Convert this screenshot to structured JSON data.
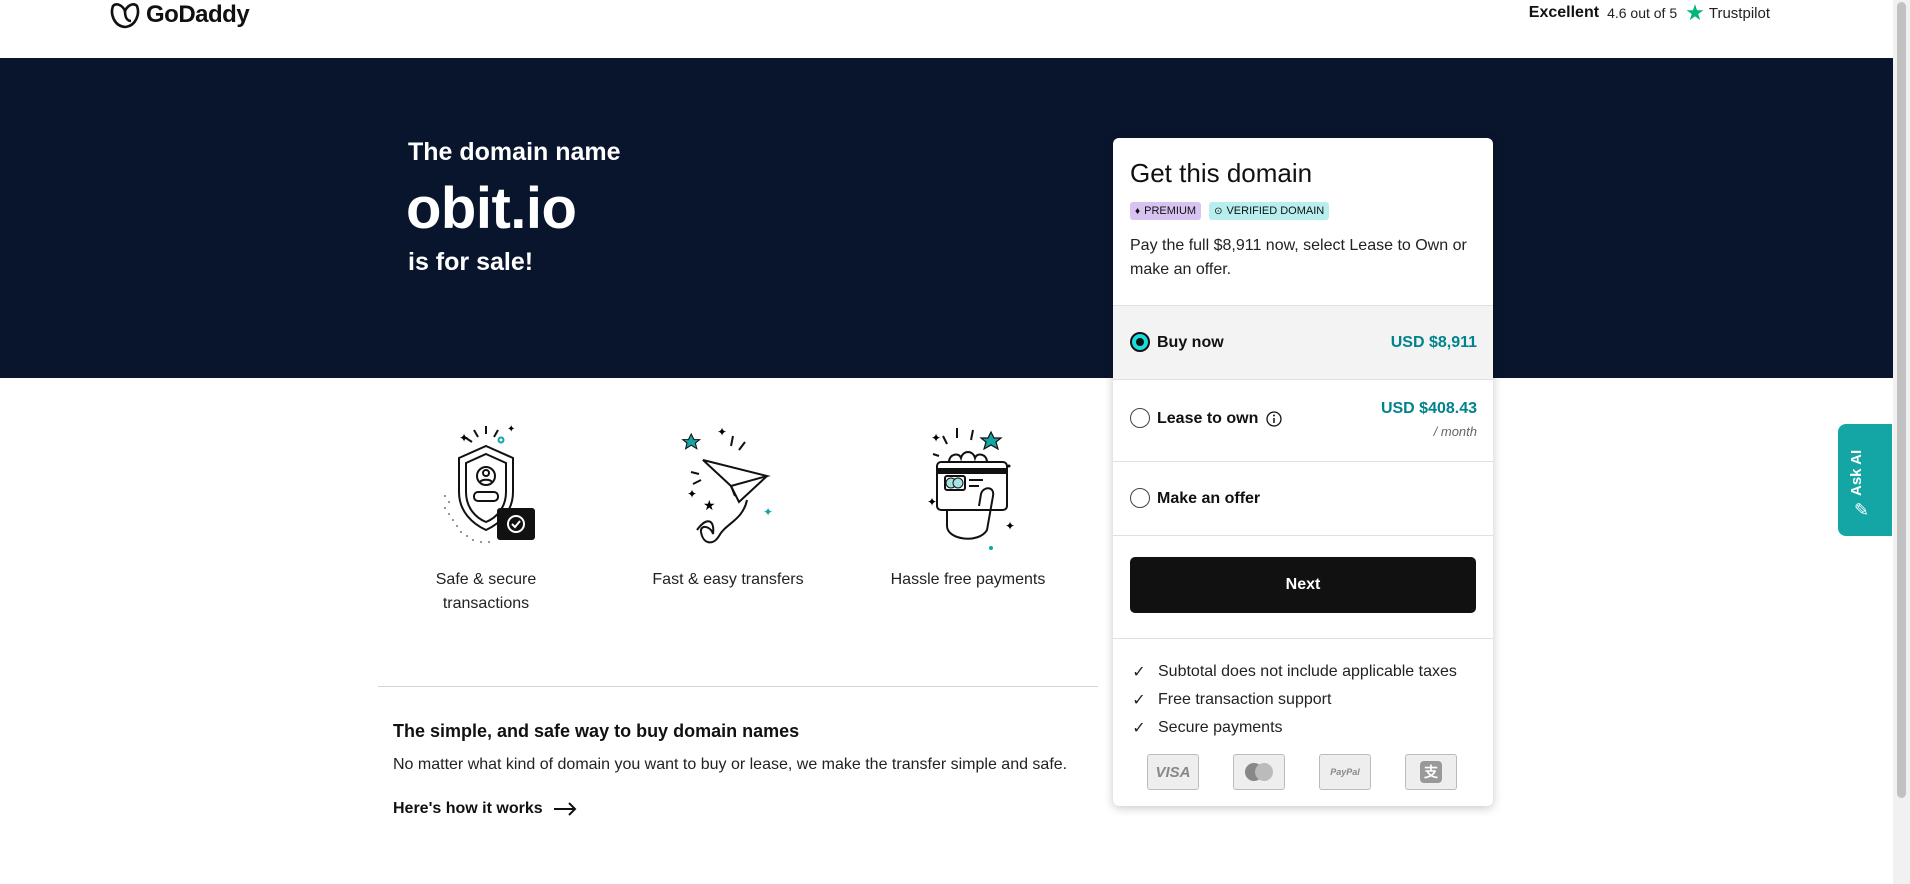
{
  "header": {
    "logo_text": "GoDaddy",
    "trust_label": "Excellent",
    "trust_rating": "4.6 out of 5",
    "trust_brand": "Trustpilot"
  },
  "hero": {
    "intro": "The domain name",
    "domain": "obit.io",
    "suffix": "is for sale!"
  },
  "features": [
    {
      "label": "Safe & secure transactions",
      "icon": "shield-icon"
    },
    {
      "label": "Fast & easy transfers",
      "icon": "paper-plane-icon"
    },
    {
      "label": "Hassle free payments",
      "icon": "card-hand-icon"
    }
  ],
  "info": {
    "title": "The simple, and safe way to buy domain names",
    "text": "No matter what kind of domain you want to buy or lease, we make the transfer simple and safe.",
    "link": "Here's how it works"
  },
  "panel": {
    "title": "Get this domain",
    "badge_premium": "PREMIUM",
    "badge_verified": "VERIFIED DOMAIN",
    "description": "Pay the full $8,911 now, select Lease to Own or make an offer.",
    "options": [
      {
        "label": "Buy now",
        "price": "USD $8,911",
        "selected": true
      },
      {
        "label": "Lease to own",
        "price": "USD $408.43",
        "sub": "/ month",
        "selected": false
      },
      {
        "label": "Make an offer",
        "selected": false
      }
    ],
    "next_label": "Next",
    "bullets": [
      "Subtotal does not include applicable taxes",
      "Free transaction support",
      "Secure payments"
    ],
    "payment_methods": [
      "VISA",
      "mastercard",
      "PayPal",
      "alipay"
    ]
  },
  "askai": {
    "label": "Ask AI"
  },
  "colors": {
    "hero_bg": "#09152d",
    "accent_teal": "#00838c",
    "askai_bg": "#13a6a5",
    "radio_fill": "#1bdbdb"
  }
}
